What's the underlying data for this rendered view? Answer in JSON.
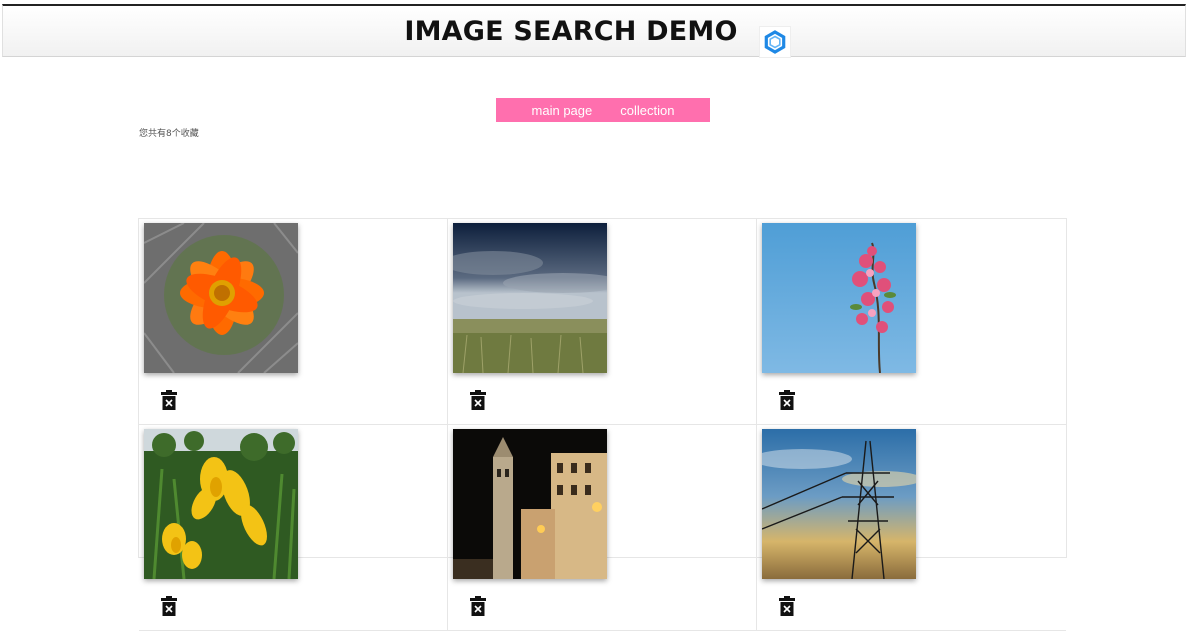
{
  "header": {
    "title": "IMAGE SEARCH DEMO",
    "logo_icon": "hexagon-logo-icon"
  },
  "nav": {
    "items": [
      {
        "label": "main page"
      },
      {
        "label": "collection"
      }
    ],
    "bg_color": "#ff6fae"
  },
  "collection": {
    "count_text": "您共有8个收藏",
    "delete_icon": "trash-icon",
    "items": [
      {
        "image": "orange-flower"
      },
      {
        "image": "stormy-sky-field"
      },
      {
        "image": "pink-blossom-blue-sky"
      },
      {
        "image": "yellow-iris-flowers"
      },
      {
        "image": "night-town-tower"
      },
      {
        "image": "power-pylon-sunset"
      }
    ]
  }
}
